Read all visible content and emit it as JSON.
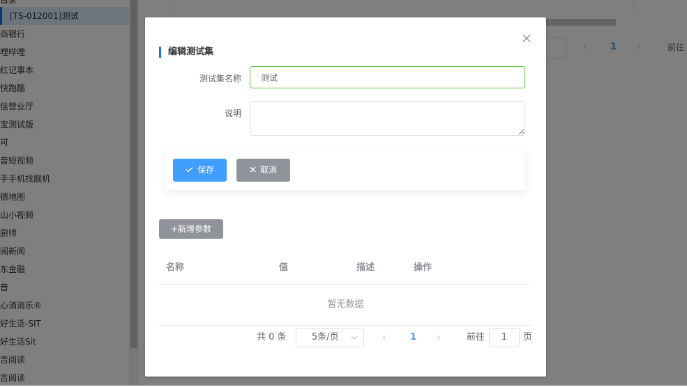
{
  "sidebar": {
    "items": [
      {
        "label": "百家",
        "active": false
      },
      {
        "label": "[TS-012001]测试",
        "active": true
      },
      {
        "label": "商银行",
        "active": false
      },
      {
        "label": "哩哔哩",
        "active": false
      },
      {
        "label": "红记事本",
        "active": false
      },
      {
        "label": "快跑酷",
        "active": false
      },
      {
        "label": "信营业厅",
        "active": false
      },
      {
        "label": "宝测试版",
        "active": false
      },
      {
        "label": "可",
        "active": false
      },
      {
        "label": "音短视频",
        "active": false
      },
      {
        "label": "手手机找靓机",
        "active": false
      },
      {
        "label": "德地图",
        "active": false
      },
      {
        "label": "山小视频",
        "active": false
      },
      {
        "label": "厨师",
        "active": false
      },
      {
        "label": "阅新闻",
        "active": false
      },
      {
        "label": "东金融",
        "active": false
      },
      {
        "label": "音",
        "active": false
      },
      {
        "label": "心消消乐®",
        "active": false
      },
      {
        "label": "好生活-SIT",
        "active": false
      },
      {
        "label": "好生活Sit",
        "active": false
      },
      {
        "label": "吉阅读",
        "active": false
      },
      {
        "label": "吉阅读",
        "active": false
      }
    ]
  },
  "background_pager": {
    "current_page": "1",
    "goto_label": "前往"
  },
  "dialog": {
    "title": "编辑测试集",
    "name_label": "测试集名称",
    "name_value": "测试",
    "desc_label": "说明",
    "desc_value": "",
    "save_label": "保存",
    "cancel_label": "取消",
    "add_param_label": "+新增参数",
    "table": {
      "columns": [
        "名称",
        "值",
        "描述",
        "操作"
      ],
      "empty_text": "暂无数据"
    },
    "pagination": {
      "total_text": "共 0 条",
      "page_size": "5条/页",
      "current_page": "1",
      "goto_label": "前往",
      "jump_value": "1",
      "page_unit": "页"
    }
  },
  "colors": {
    "primary": "#409eff",
    "success_border": "#67c23a",
    "grey_button": "#909399",
    "title_bar": "#1a73e8"
  }
}
